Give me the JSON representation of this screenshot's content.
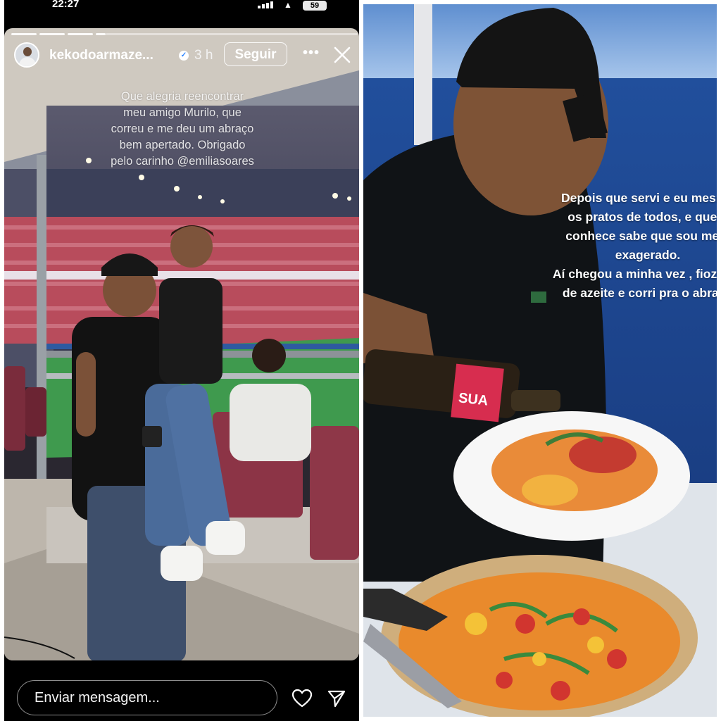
{
  "status_bar": {
    "time": "22:27",
    "battery": "59"
  },
  "story": {
    "username": "kekodoarmaze...",
    "time_ago": "3 h",
    "follow_label": "Seguir",
    "more_icon": "more-icon",
    "close_icon": "close-icon",
    "caption_lines": [
      "Que alegria reencontrar",
      "meu amigo Murilo, que",
      "correu e me deu um abraço",
      "bem apertado. Obrigado",
      "pelo carinho @emiliasoares"
    ],
    "reply_placeholder": "Enviar mensagem...",
    "like_icon": "heart-icon",
    "send_icon": "send-icon"
  },
  "right_story": {
    "caption_lines": [
      "Depois que servi e eu mesmo",
      "os pratos de todos, e quem",
      "conhece sabe que sou meio",
      "exagerado.",
      "Aí chegou a minha vez , fiozinho",
      "de azeite e corri pra o abraço"
    ],
    "bottle_label": "SUA"
  },
  "colors": {
    "background": "#000000",
    "text": "#ffffff",
    "ocean": "#1d4f9c"
  }
}
